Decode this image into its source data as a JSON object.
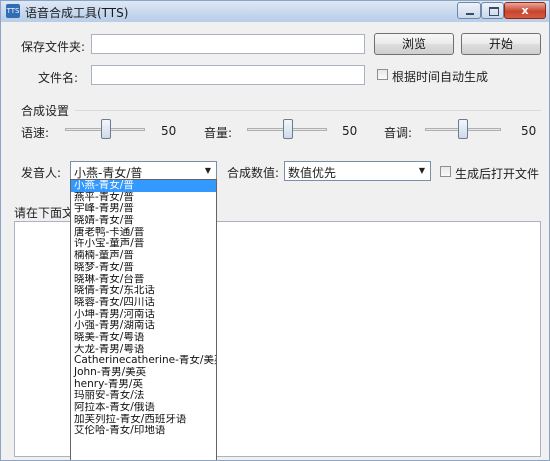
{
  "window": {
    "title": "语音合成工具(TTS)",
    "icon": "app-tts-icon",
    "close_glyph": "x"
  },
  "save_folder": {
    "label": "保存文件夹:",
    "value": ""
  },
  "buttons": {
    "browse": "浏览",
    "start": "开始"
  },
  "filename": {
    "label": "文件名:",
    "value": "",
    "auto_label": "根据时间自动生成",
    "auto_checked": false
  },
  "settings": {
    "group_label": "合成设置",
    "speed": {
      "label": "语速:",
      "value": "50"
    },
    "volume": {
      "label": "音量:",
      "value": "50"
    },
    "pitch": {
      "label": "音调:",
      "value": "50"
    }
  },
  "speaker": {
    "label": "发音人:",
    "selected": "小燕-青女/普"
  },
  "synth_value": {
    "label": "合成数值:",
    "selected": "数值优先"
  },
  "open_after": {
    "label": "生成后打开文件",
    "checked": false
  },
  "input_label": "请在下面文",
  "speaker_options": [
    "小燕-青女/普",
    "燕平-青女/普",
    "宇峰-青男/普",
    "晓婧-青女/普",
    "唐老鸭-卡通/普",
    "许小宝-童声/普",
    "楠楠-童声/普",
    "晓梦-青女/普",
    "晓琳-青女/台普",
    "晓倩-青女/东北话",
    "晓蓉-青女/四川话",
    "小坤-青男/河南话",
    "小强-青男/湖南话",
    "晓美-青女/粤语",
    "大龙-青男/粤语",
    "Catherinecatherine-青女/美英",
    "John-青男/美英",
    "henry-青男/英",
    "玛丽安-青女/法",
    "阿拉本-青女/俄语",
    "加芙列拉-青女/西班牙语",
    "艾伦哈-青女/印地语"
  ]
}
